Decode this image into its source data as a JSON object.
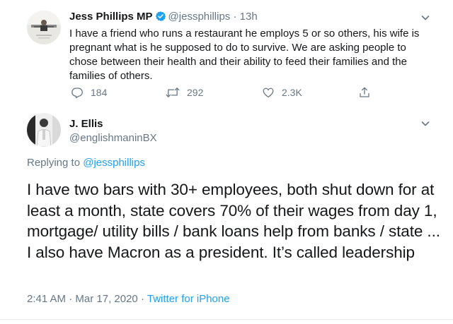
{
  "tweet1": {
    "name": "Jess Phillips MP",
    "handle": "@jessphillips",
    "separator": "·",
    "time": "13h",
    "text": "I have a friend who runs a restaurant he employs 5 or so others, his wife is pregnant what is he supposed to do to survive. We are asking people to chose between their health and their ability to feed their families and the families of others.",
    "actions": {
      "replies": "184",
      "retweets": "292",
      "likes": "2.3K"
    }
  },
  "tweet2": {
    "name": "J. Ellis",
    "handle": "@englishmaninBX",
    "replying_prefix": "Replying to",
    "replying_handle": "@jessphillips",
    "text": "I have two bars with 30+ employees, both shut down for at least a month, state covers 70% of their wages from day 1, mortgage/ utility bills / bank loans help from banks / state ... I also have Macron as a president. It’s called leadership",
    "time": "2:41 AM",
    "date": "Mar 17, 2020",
    "source": "Twitter for iPhone",
    "meta_separator": "·"
  },
  "colors": {
    "text": "#14171a",
    "muted": "#657786",
    "link": "#1da1f2",
    "divider": "#e6ecf0"
  },
  "icons": [
    "verified-badge-icon",
    "chevron-down-icon",
    "reply-icon",
    "retweet-icon",
    "like-icon",
    "share-icon"
  ]
}
